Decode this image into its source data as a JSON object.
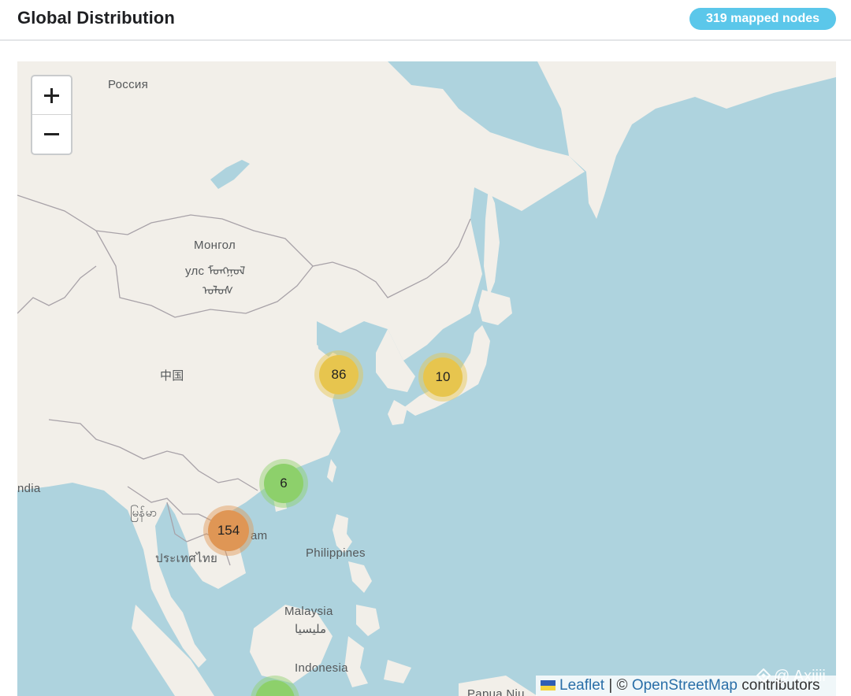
{
  "header": {
    "title": "Global Distribution",
    "badge": "319 mapped nodes"
  },
  "map": {
    "zoom_in_label": "+",
    "zoom_out_label": "−",
    "labels": {
      "russia": "Россия",
      "mongolia_1": "Монгол",
      "mongolia_2": "улс ᠮᠣᠩᠭᠣᠯ",
      "mongolia_3": "ᠤᠯᠤᠰ",
      "china": "中国",
      "india": "ndia",
      "myanmar": "မြန်မာ",
      "thailand": "ประเทศไทย",
      "vietnam": "am",
      "philippines": "Philippines",
      "malaysia_1": "Malaysia",
      "malaysia_2": "مليسيا",
      "indonesia": "Indonesia",
      "papua": "Papua Niu"
    },
    "clusters": [
      {
        "name": "cluster-shanghai",
        "count": "86",
        "size": "medium",
        "color": "#e7c54e"
      },
      {
        "name": "cluster-tokyo",
        "count": "10",
        "size": "medium",
        "color": "#e7c54e"
      },
      {
        "name": "cluster-hong-kong",
        "count": "6",
        "size": "small",
        "color": "#8dd06b"
      },
      {
        "name": "cluster-vietnam",
        "count": "154",
        "size": "large",
        "color": "#df9655"
      }
    ],
    "colors": {
      "sea": "#aed3de",
      "land": "#f2efe9",
      "border": "#a8a2a8",
      "cluster_small": "#8dd06b",
      "cluster_medium": "#e7c54e",
      "cluster_large": "#df9655"
    }
  },
  "attribution": {
    "leaflet": "Leaflet",
    "separator": " | © ",
    "osm": "OpenStreetMap",
    "contributors": " contributors"
  },
  "watermark": {
    "text": "@ Axiiii"
  }
}
